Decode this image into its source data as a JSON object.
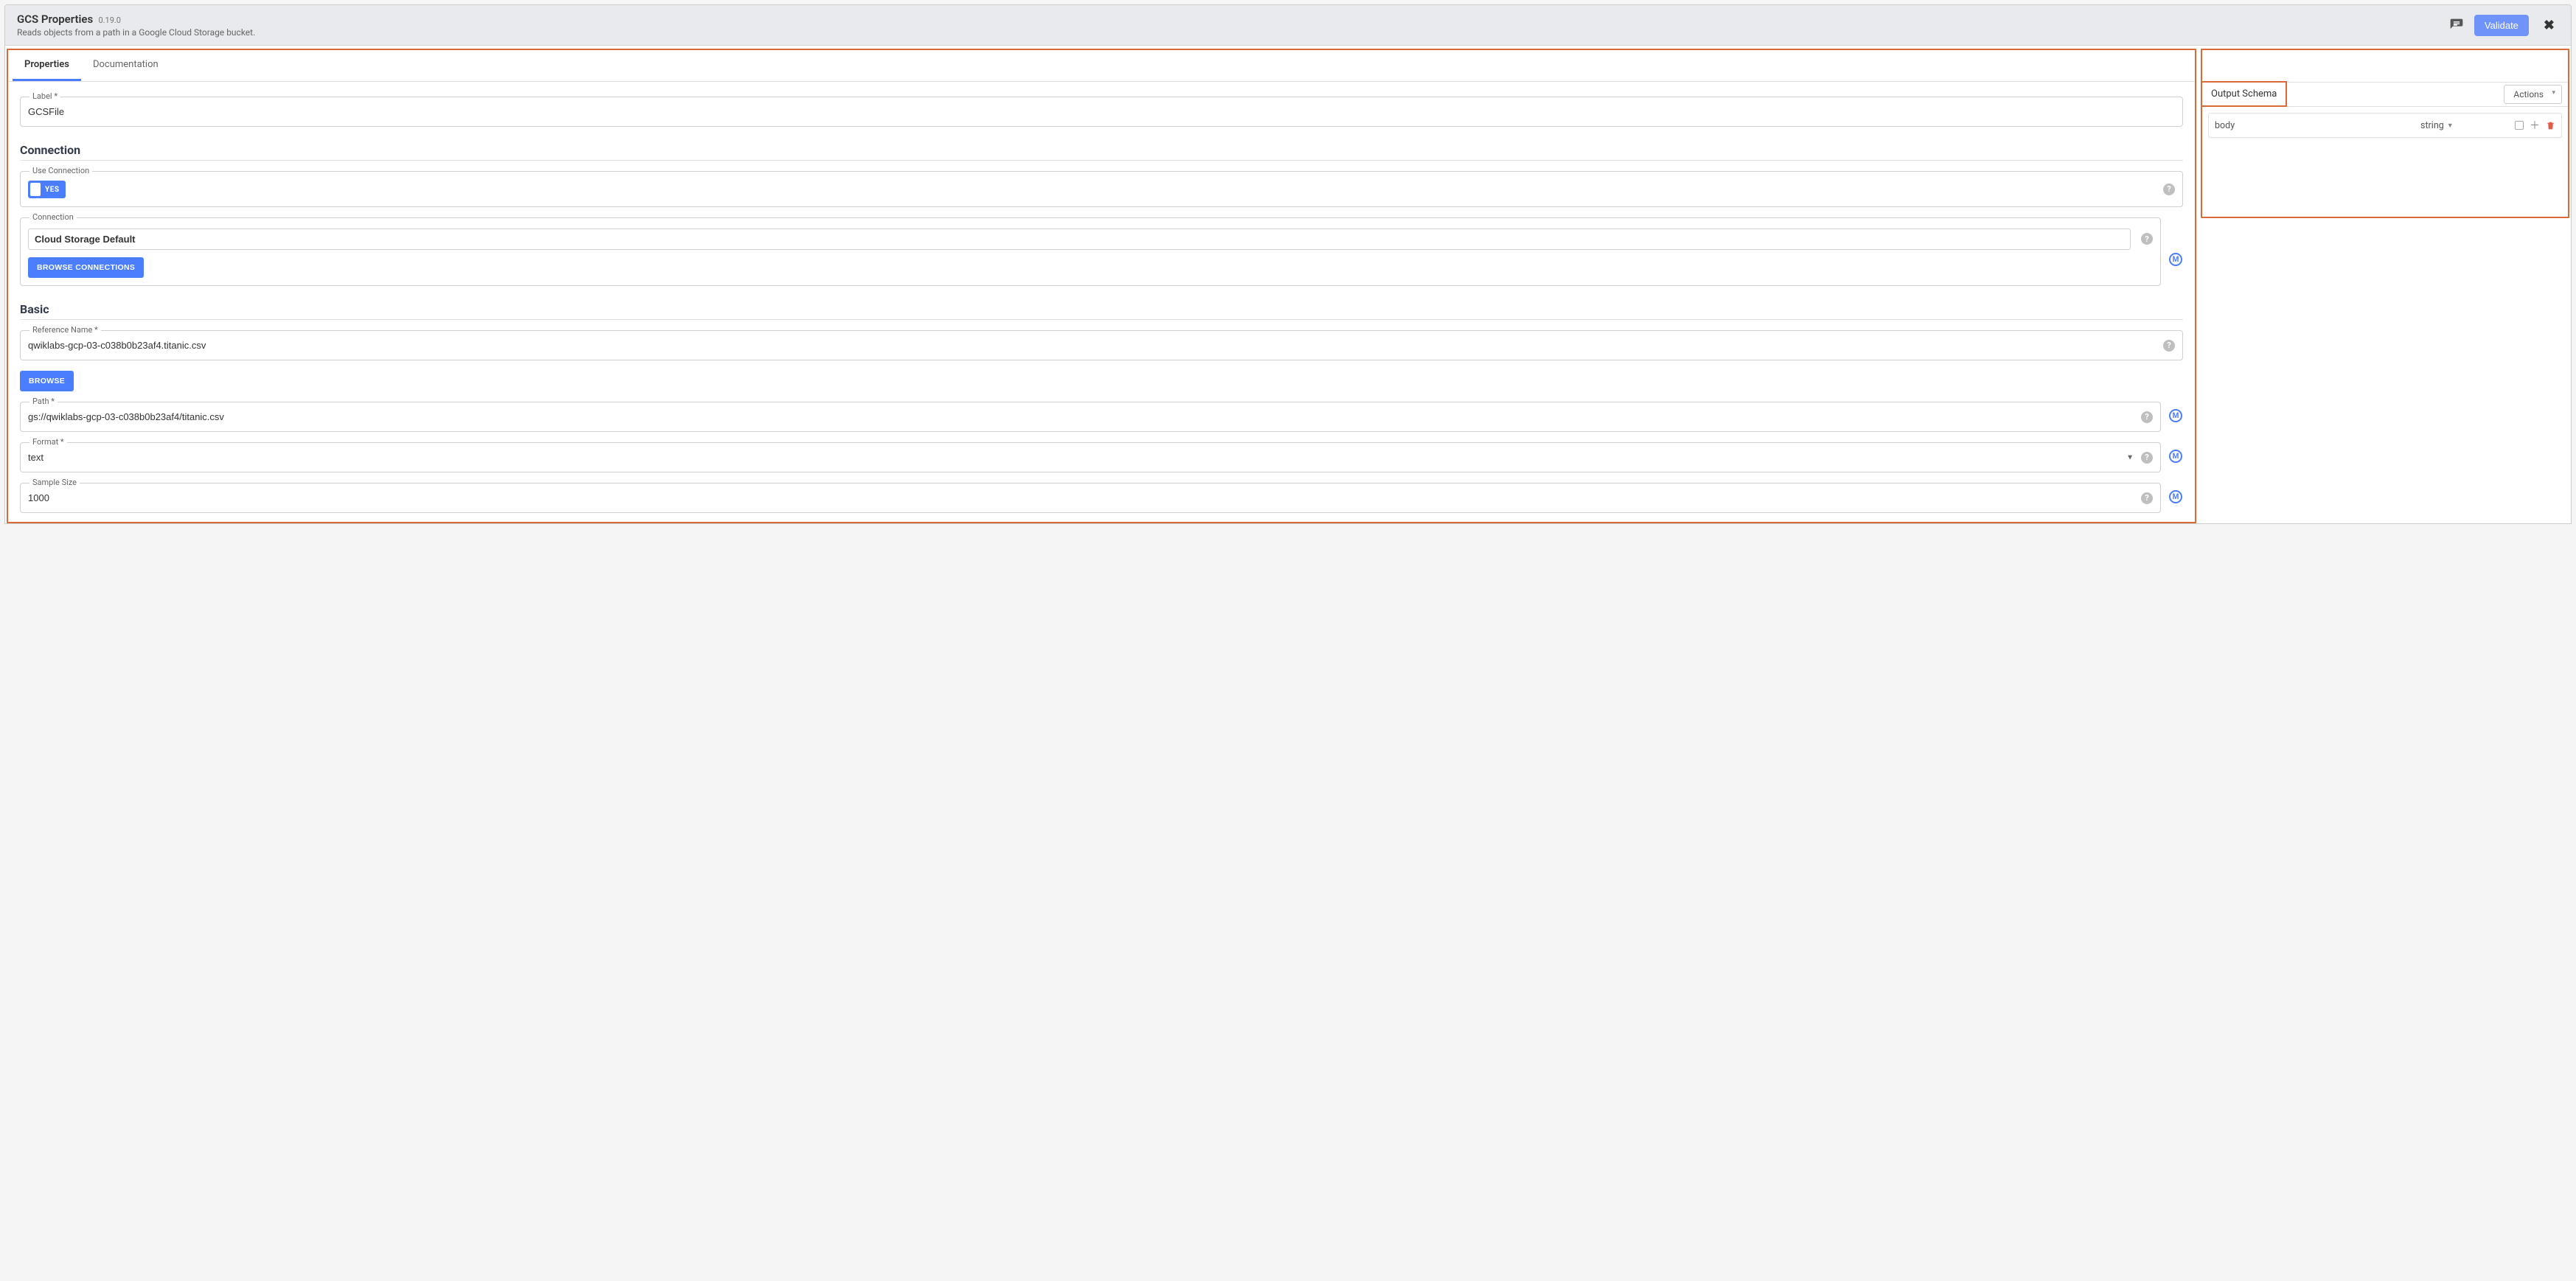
{
  "header": {
    "title": "GCS Properties",
    "version": "0.19.0",
    "subtitle": "Reads objects from a path in a Google Cloud Storage bucket.",
    "validate": "Validate"
  },
  "tabs": {
    "properties": "Properties",
    "documentation": "Documentation"
  },
  "fields": {
    "label": {
      "legend": "Label *",
      "value": "GCSFile"
    },
    "use_connection": {
      "legend": "Use Connection",
      "toggle_label": "YES"
    },
    "connection_field": {
      "legend": "Connection",
      "value": "Cloud Storage Default",
      "browse": "BROWSE CONNECTIONS"
    },
    "reference_name": {
      "legend": "Reference Name *",
      "value": "qwiklabs-gcp-03-c038b0b23af4.titanic.csv"
    },
    "browse": "BROWSE",
    "path": {
      "legend": "Path *",
      "value": "gs://qwiklabs-gcp-03-c038b0b23af4/titanic.csv"
    },
    "format": {
      "legend": "Format *",
      "value": "text"
    },
    "sample_size": {
      "legend": "Sample Size",
      "value": "1000"
    }
  },
  "sections": {
    "connection": "Connection",
    "basic": "Basic"
  },
  "right": {
    "title": "Output Schema",
    "actions": "Actions",
    "row": {
      "name": "body",
      "type": "string"
    }
  },
  "glyphs": {
    "help": "?",
    "macro": "M"
  }
}
